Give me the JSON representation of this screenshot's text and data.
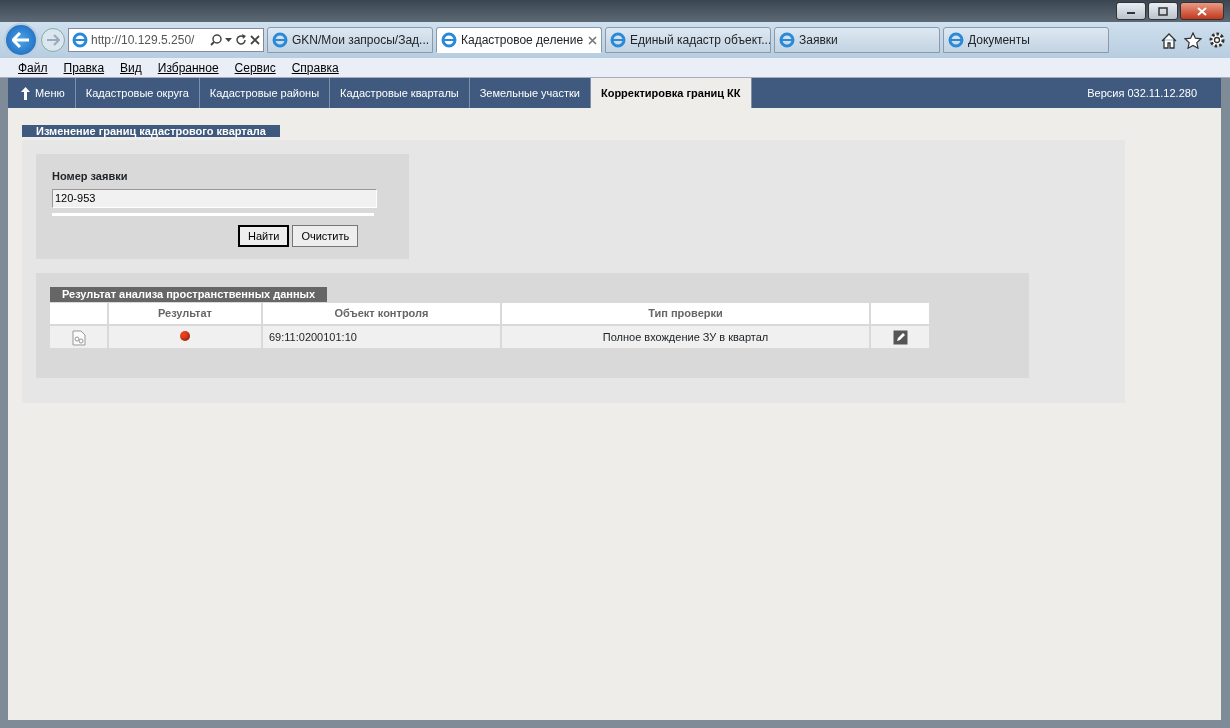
{
  "browser": {
    "address": "http://10.129.5.250/",
    "tabs": [
      {
        "title": "GKN/Мои запросы/Зад...",
        "selected": false
      },
      {
        "title": "Кадастровое деление",
        "selected": true
      },
      {
        "title": "Единый кадастр объект...",
        "selected": false
      },
      {
        "title": "Заявки",
        "selected": false
      },
      {
        "title": "Документы",
        "selected": false
      }
    ],
    "menu": [
      {
        "label": "Файл"
      },
      {
        "label": "Правка"
      },
      {
        "label": "Вид"
      },
      {
        "label": "Избранное"
      },
      {
        "label": "Сервис"
      },
      {
        "label": "Справка"
      }
    ]
  },
  "app_nav": {
    "items": [
      {
        "label": "Меню",
        "kind": "home",
        "selected": false
      },
      {
        "label": "Кадастровые округа",
        "kind": "link",
        "selected": false
      },
      {
        "label": "Кадастровые районы",
        "kind": "link",
        "selected": false
      },
      {
        "label": "Кадастровые кварталы",
        "kind": "link",
        "selected": false
      },
      {
        "label": "Земельные участки",
        "kind": "link",
        "selected": false
      },
      {
        "label": "Корректировка границ КК",
        "kind": "link",
        "selected": true
      }
    ],
    "version": "Версия 032.11.12.280"
  },
  "section": {
    "title": "Изменение границ кадастрового квартала",
    "search": {
      "label": "Номер заявки",
      "value": "120-953",
      "buttons": [
        {
          "label": "Найти",
          "default": true
        },
        {
          "label": "Очистить",
          "default": false
        }
      ]
    },
    "results": {
      "title": "Результат анализа пространственных данных",
      "columns": [
        "Результат",
        "Объект контроля",
        "Тип проверки"
      ],
      "rows": [
        {
          "color": "#e8401c",
          "object": "69:11:0200101:10",
          "check": "Полное вхождение ЗУ в квартал"
        }
      ]
    }
  }
}
